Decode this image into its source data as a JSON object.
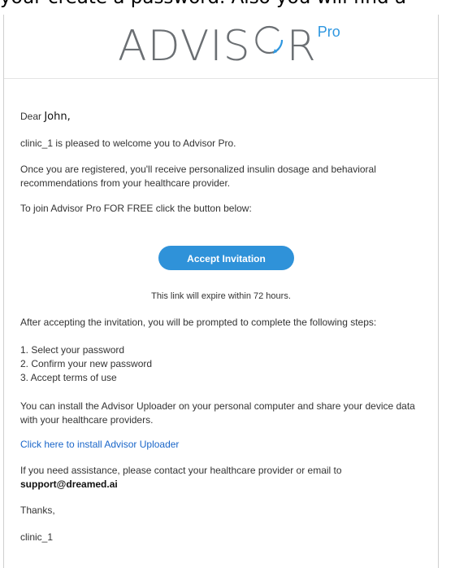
{
  "top_cut_text": "your create a password. Also you will find a",
  "logo": {
    "text_pre": "ADVIS",
    "text_post": "R",
    "superscript": "Pro"
  },
  "greeting": {
    "prefix": "Dear ",
    "name": "John,"
  },
  "paragraphs": {
    "welcome": "clinic_1 is pleased to welcome you to Advisor Pro.",
    "registered": "Once you are registered, you'll receive personalized insulin dosage and behavioral recommendations from your healthcare provider.",
    "join": "To join Advisor Pro FOR FREE click the button below:"
  },
  "accept_button": "Accept Invitation",
  "expire_note": "This link will expire within 72 hours.",
  "steps_intro": "After accepting the invitation, you will be prompted to complete the following steps:",
  "steps": [
    "1. Select your password",
    "2. Confirm your new password",
    "3. Accept terms of use"
  ],
  "uploader_text": "You can install the Advisor Uploader on your personal computer and share your device data with your healthcare providers.",
  "uploader_link": "Click here to install Advisor Uploader",
  "assistance_text": "If you need assistance, please contact your healthcare provider or email to",
  "support_email": "support@dreamed.ai",
  "thanks": "Thanks,",
  "signature": "clinic_1",
  "colors": {
    "accent": "#2f92d9",
    "logo_gray": "#6b6f73",
    "link": "#1a66c9"
  }
}
